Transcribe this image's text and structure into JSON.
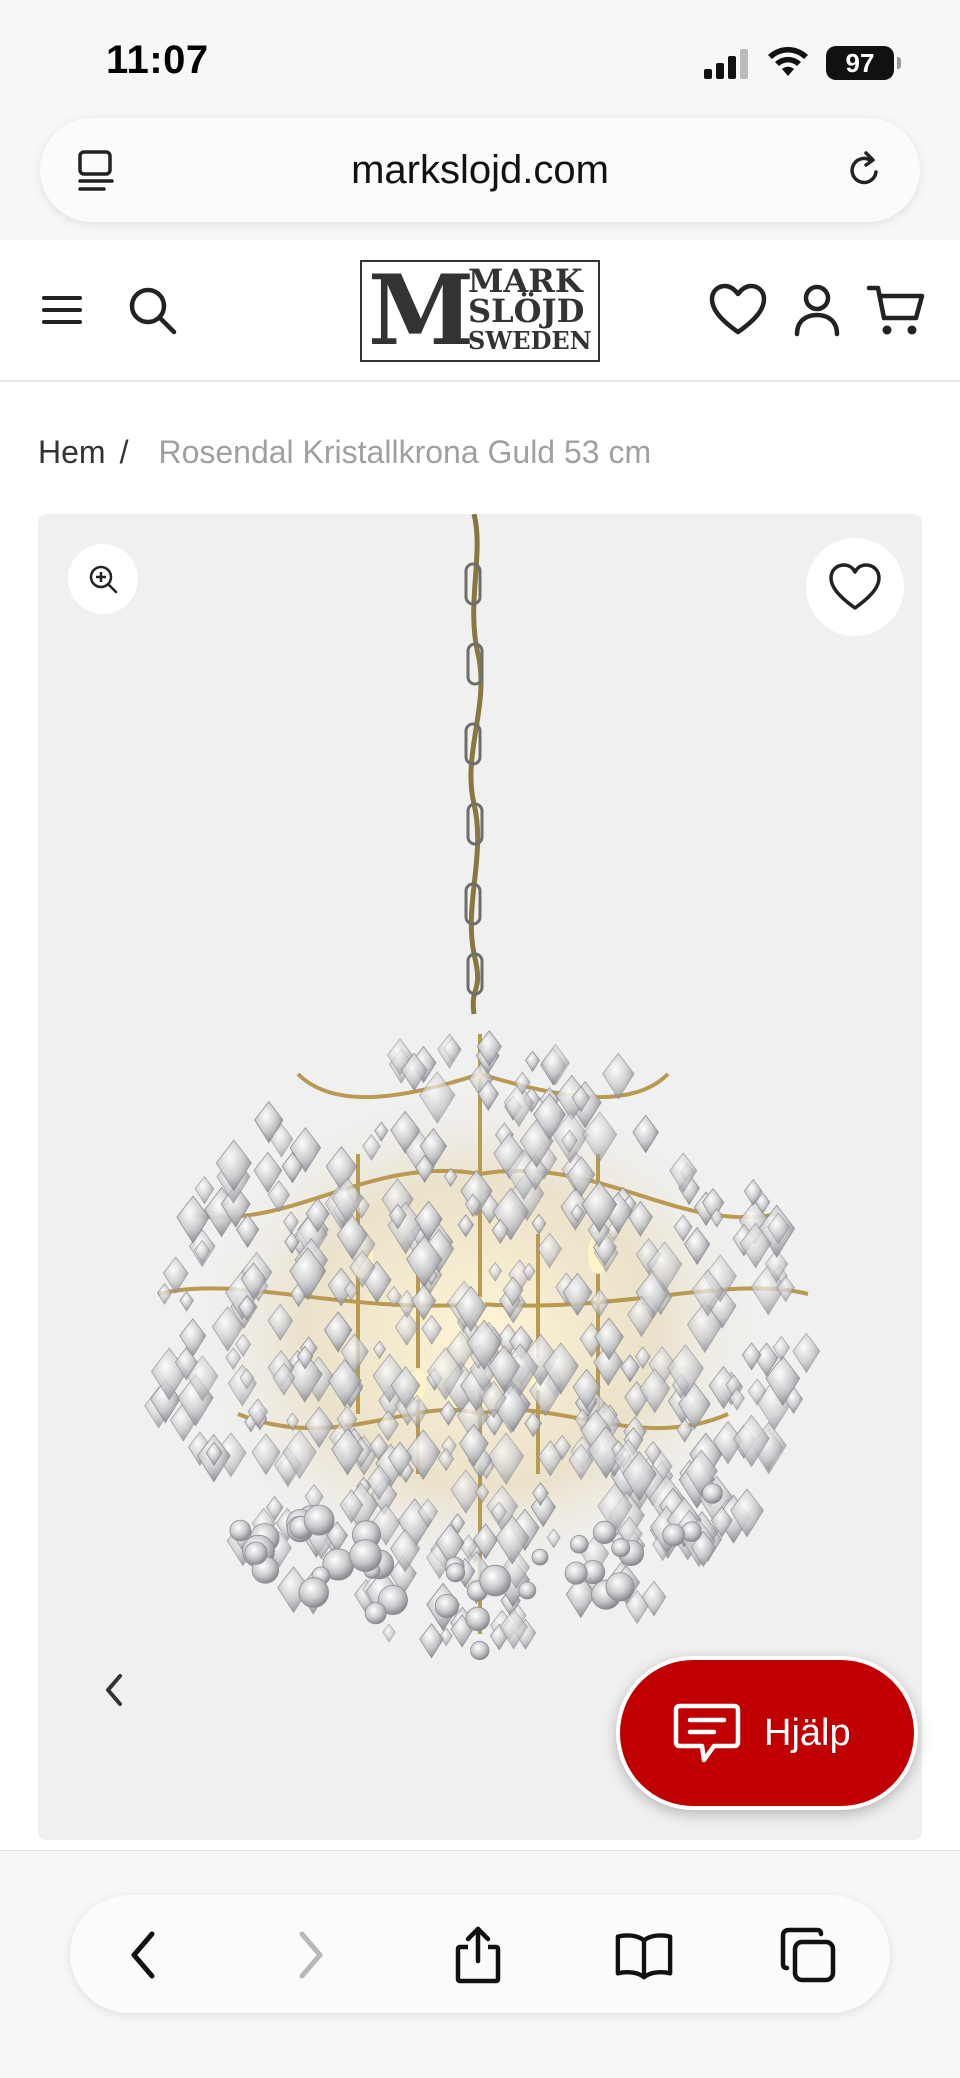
{
  "status_bar": {
    "time": "11:07",
    "battery": "97"
  },
  "browser": {
    "url": "markslojd.com"
  },
  "header": {
    "logo": {
      "letter": "M",
      "line1": "MARK",
      "line2": "SLÖJD",
      "line3": "SWEDEN"
    },
    "icons": [
      "menu-icon",
      "search-icon",
      "heart-icon",
      "user-icon",
      "cart-icon"
    ]
  },
  "breadcrumb": {
    "home": "Hem",
    "separator": "/",
    "current": "Rosendal Kristallkrona Guld 53 cm"
  },
  "help": {
    "label": "Hjälp"
  },
  "colors": {
    "accent": "#c00000",
    "gallery_bg": "#f0f0f0"
  }
}
